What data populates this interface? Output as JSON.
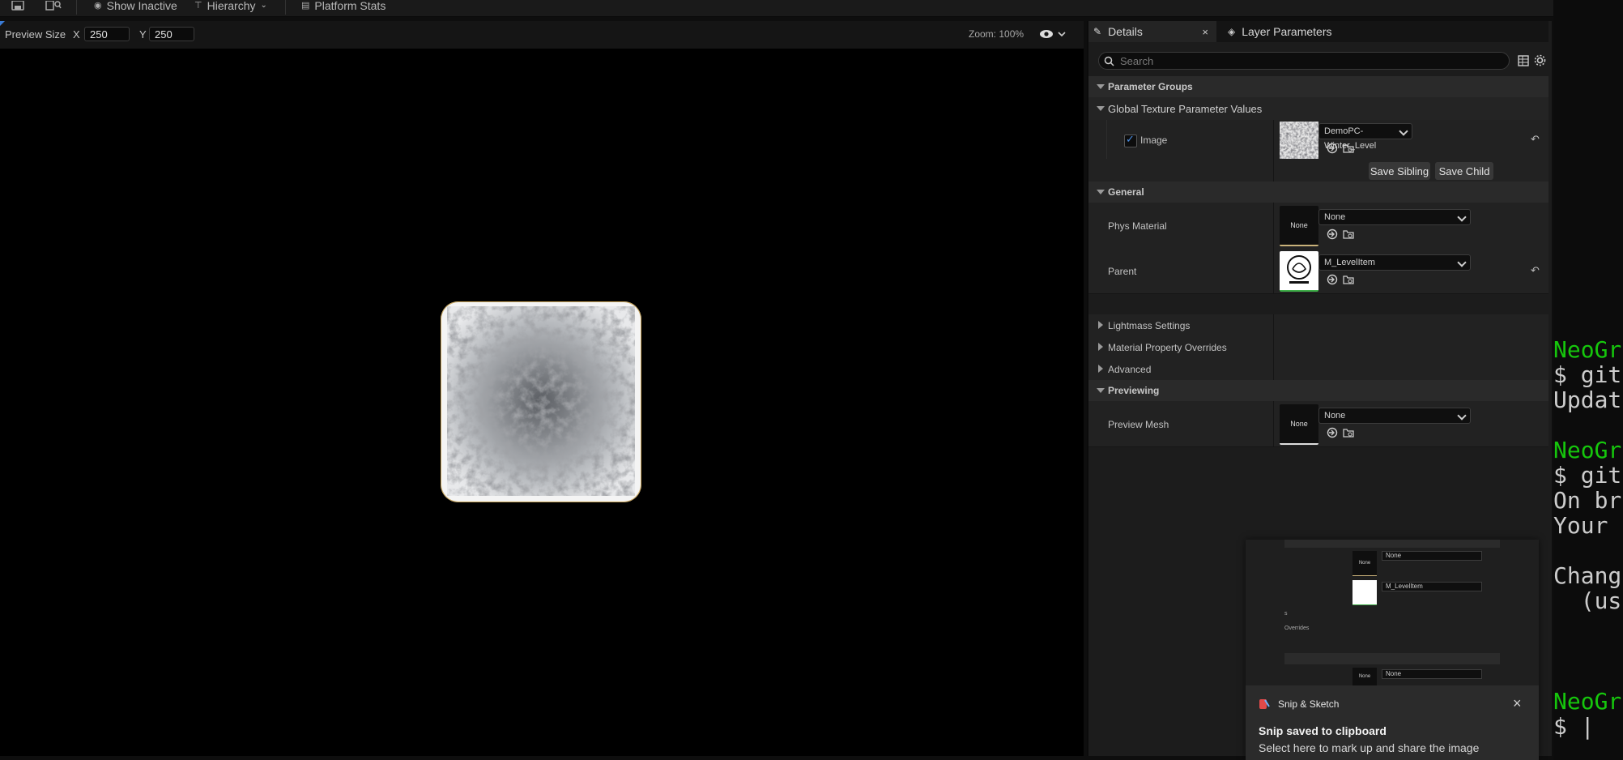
{
  "toolbar": {
    "show_inactive": "Show Inactive",
    "hierarchy": "Hierarchy",
    "platform_stats": "Platform Stats"
  },
  "viewport": {
    "preview_size_label": "Preview Size",
    "x_label": "X",
    "x_value": "250",
    "y_label": "Y",
    "y_value": "250",
    "zoom": "Zoom: 100%"
  },
  "details": {
    "tab_details": "Details",
    "tab_layer_parameters": "Layer Parameters",
    "search_placeholder": "Search",
    "parameter_groups": "Parameter Groups",
    "global_texture": "Global Texture Parameter Values",
    "image_label": "Image",
    "image_checked": true,
    "image_asset": "DemoPC-Winter_Level",
    "save_sibling": "Save Sibling",
    "save_child": "Save Child",
    "general": "General",
    "phys_material_label": "Phys Material",
    "phys_material_value": "None",
    "phys_material_thumb": "None",
    "parent_label": "Parent",
    "parent_value": "M_LevelItem",
    "lightmass": "Lightmass Settings",
    "material_overrides": "Material Property Overrides",
    "advanced": "Advanced",
    "previewing": "Previewing",
    "preview_mesh_label": "Preview Mesh",
    "preview_mesh_value": "None",
    "preview_mesh_thumb": "None"
  },
  "toast": {
    "preview_none_1": "None",
    "preview_none_1_thumb": "None",
    "preview_parent": "M_LevelItem",
    "preview_frag_1": "s",
    "preview_frag_2": "Overrides",
    "preview_none_2": "None",
    "preview_none_2_thumb": "None",
    "app_name": "Snip & Sketch",
    "title": "Snip saved to clipboard",
    "subtitle": "Select here to mark up and share the image"
  },
  "terminal": {
    "line1": "NeoGr",
    "line2": "$ git",
    "line3": "Updat",
    "line4": "NeoGr",
    "line5": "$ git",
    "line6": "On br",
    "line7": "Your ",
    "line8": "Chang",
    "line9": "  (us",
    "line10": "NeoGr",
    "line11": "$ |"
  },
  "colors": {
    "accent_blue": "#3a7bd5",
    "terminal_green": "#16c60c",
    "panel_bg": "#1c1c1c"
  }
}
